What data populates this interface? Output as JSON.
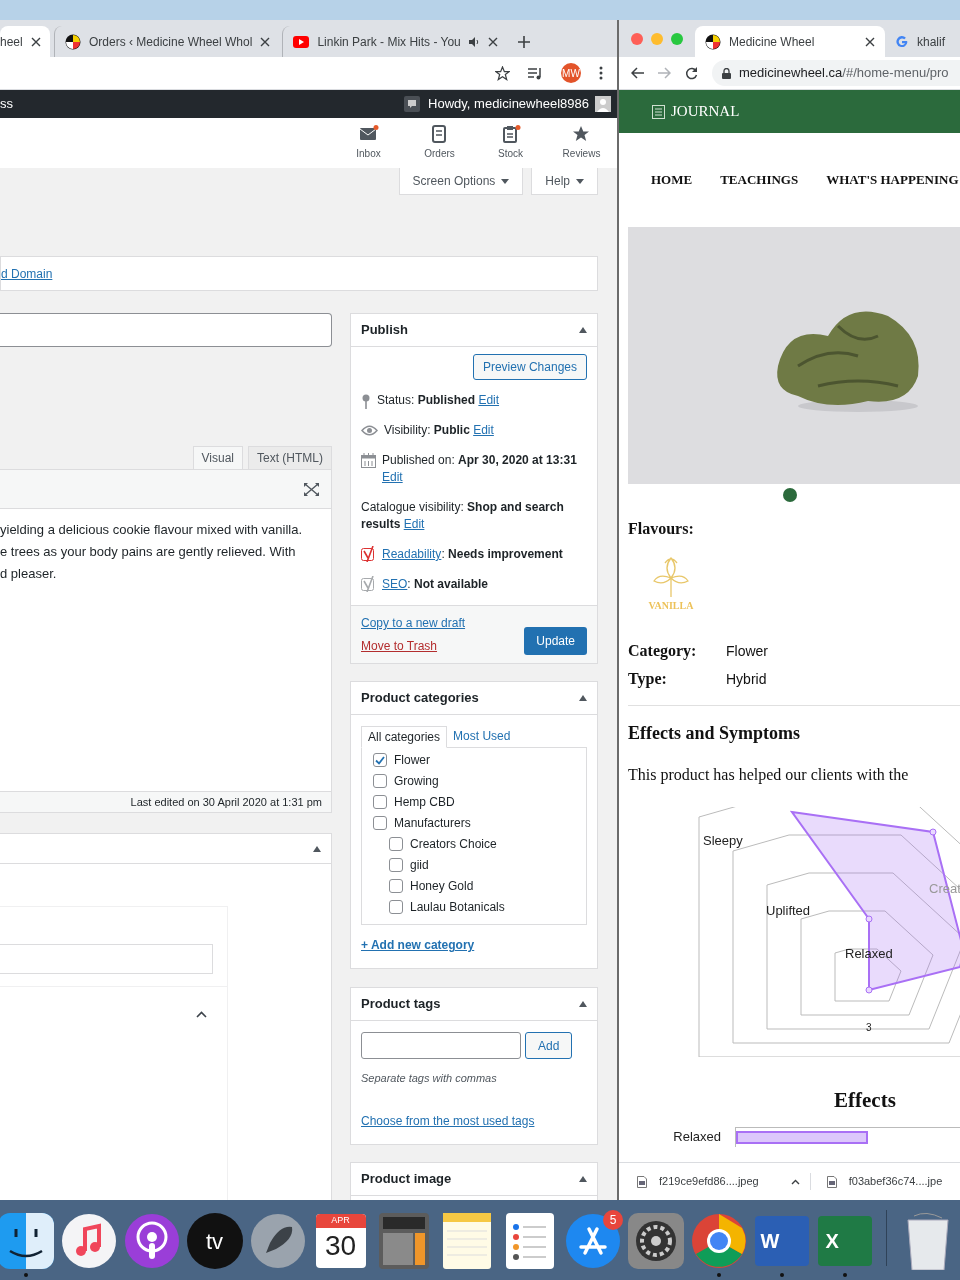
{
  "left_browser": {
    "tabs": [
      {
        "title": "heel",
        "selected": true,
        "audio": false
      },
      {
        "title": "Orders ‹ Medicine Wheel Whol",
        "selected": false,
        "kind": "wheel",
        "audio": false
      },
      {
        "title": "Linkin Park - Mix Hits - You",
        "selected": false,
        "kind": "video",
        "audio": true
      }
    ],
    "profile": "MW"
  },
  "admin_bar": {
    "site": "ss",
    "greeting": "Howdy, medicinewheel8986"
  },
  "activity": [
    {
      "label": "Inbox",
      "kind": "inbox",
      "alert": true
    },
    {
      "label": "Orders",
      "kind": "orders",
      "alert": false
    },
    {
      "label": "Stock",
      "kind": "stock",
      "alert": true
    },
    {
      "label": "Reviews",
      "kind": "reviews",
      "alert": false
    }
  ],
  "screen_meta": [
    "Screen Options",
    "Help"
  ],
  "notice_link": "d Domain",
  "editor": {
    "tabs": [
      {
        "label": "Visual",
        "selected": true
      },
      {
        "label": "Text (HTML)",
        "selected": false
      }
    ],
    "lines": [
      "yielding a delicious cookie flavour mixed with vanilla.",
      "e trees as your body pains are gently relieved. With",
      "d pleaser."
    ],
    "last_edited": "Last edited on 30 April 2020 at 1:31 pm"
  },
  "publish": {
    "title": "Publish",
    "preview": "Preview Changes",
    "rows": [
      {
        "kind": "status",
        "text": "Status: **Published**",
        "link": "Edit"
      },
      {
        "kind": "visibility",
        "text": "Visibility: **Public**",
        "link": "Edit"
      },
      {
        "kind": "date",
        "text": "Published on: **Apr 30, 2020 at 13:31**",
        "link": "Edit"
      },
      {
        "kind": "catalogue",
        "text": "Catalogue visibility: **Shop and search results**",
        "link": "Edit"
      },
      {
        "kind": "readability",
        "link": "Readability",
        "text": ": **Needs improvement**"
      },
      {
        "kind": "seo",
        "link": "SEO",
        "text": ": **Not available**"
      }
    ],
    "copy": "Copy to a new draft",
    "trash": "Move to Trash",
    "update": "Update"
  },
  "categories": {
    "title": "Product categories",
    "tabs": [
      {
        "label": "All categories",
        "selected": true
      },
      {
        "label": "Most Used",
        "selected": false
      }
    ],
    "items": [
      {
        "label": "Flower",
        "checked": true
      },
      {
        "label": "Growing",
        "checked": false
      },
      {
        "label": "Hemp CBD",
        "checked": false
      },
      {
        "label": "Manufacturers",
        "checked": false,
        "children": [
          {
            "label": "Creators Choice",
            "checked": false
          },
          {
            "label": "giid",
            "checked": false
          },
          {
            "label": "Honey Gold",
            "checked": false
          },
          {
            "label": "Laulau Botanicals",
            "checked": false
          }
        ]
      }
    ],
    "add": "+ Add new category"
  },
  "tags": {
    "title": "Product tags",
    "button": "Add",
    "hint": "Separate tags with commas",
    "link": "Choose from the most used tags"
  },
  "product_image": {
    "title": "Product image"
  },
  "right_browser": {
    "tabs": [
      {
        "title": "Medicine Wheel",
        "selected": true,
        "kind": "wheel"
      },
      {
        "title": "khalif",
        "selected": false,
        "kind": "google"
      }
    ],
    "url_host": "medicinewheel.ca",
    "url_path": "/#/home-menu/pro"
  },
  "site": {
    "header": "JOURNAL",
    "nav": [
      "HOME",
      "TEACHINGS",
      "WHAT'S HAPPENING"
    ],
    "carousel_dots": [
      {
        "selected": true
      }
    ],
    "flavours_label": "Flavours:",
    "flavour": "VANILLA",
    "facts": [
      {
        "label": "Category:",
        "value": "Flower"
      },
      {
        "label": "Type:",
        "value": "Hybrid"
      }
    ],
    "effects_heading": "Effects and Symptoms",
    "effects_intro": "This product has helped our clients with the",
    "radar_labels": [
      "Sleepy",
      "Uplifted",
      "Creat",
      "Relaxed"
    ],
    "radar_tick": "3",
    "bar_title": "Effects",
    "bar_labels": [
      "Relaxed"
    ]
  },
  "downloads": [
    "f219ce9efd86....jpeg",
    "f03abef36c74....jpe"
  ],
  "dock": [
    {
      "kind": "finder",
      "running": true
    },
    {
      "kind": "music",
      "running": false
    },
    {
      "kind": "podcasts",
      "running": false
    },
    {
      "kind": "tv",
      "label": "tv",
      "running": false
    },
    {
      "kind": "launchpad",
      "running": false
    },
    {
      "kind": "calendar",
      "month": "APR",
      "day": "30",
      "running": false
    },
    {
      "kind": "calculator",
      "running": false
    },
    {
      "kind": "notes",
      "running": false
    },
    {
      "kind": "reminders",
      "running": false
    },
    {
      "kind": "appstore",
      "badge": "5",
      "running": false
    },
    {
      "kind": "preferences",
      "running": false
    },
    {
      "kind": "chrome",
      "running": true
    },
    {
      "kind": "word",
      "label": "W",
      "running": true
    },
    {
      "kind": "excel",
      "label": "X",
      "running": true
    },
    {
      "kind": "trash",
      "running": false
    }
  ]
}
